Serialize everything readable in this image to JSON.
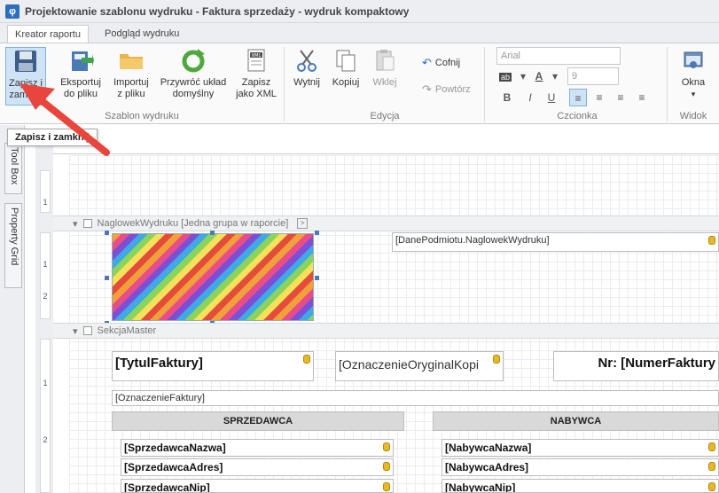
{
  "window": {
    "title": "Projektowanie szablonu wydruku - Faktura sprzedaży - wydruk kompaktowy"
  },
  "tabs": {
    "active": "Kreator raportu",
    "inactive": "Podgląd wydruku"
  },
  "ribbon": {
    "save_line1": "Zapisz i",
    "save_line2": "zamknij",
    "export_line1": "Eksportuj",
    "export_line2": "do pliku",
    "import_line1": "Importuj",
    "import_line2": "z pliku",
    "restore_line1": "Przywróć układ",
    "restore_line2": "domyślny",
    "savexml_line1": "Zapisz",
    "savexml_line2": "jako XML",
    "group_template": "Szablon wydruku",
    "cut": "Wytnij",
    "copy": "Kopiuj",
    "paste": "Wklej",
    "undo": "Cofnij",
    "redo": "Powtórz",
    "group_edit": "Edycja",
    "font_name": "Arial",
    "font_size": "9",
    "group_font": "Czcionka",
    "window_label": "Okna",
    "group_view": "Widok"
  },
  "tooltip": "Zapisz i zamknij",
  "dock": {
    "toolbox": "Tool Box",
    "property_grid": "Property Grid"
  },
  "ruler": {
    "one": "1",
    "two": "2"
  },
  "bands": {
    "header": "NaglowekWydruku [Jedna grupa w raporcie]",
    "master": "SekcjaMaster"
  },
  "fields": {
    "dane_podmiotu": "[DanePodmiotu.NaglowekWydruku]",
    "tytul": "[TytulFaktury]",
    "oznaczenie_oryginal": "[OznaczenieOryginalKopi",
    "nr": "Nr: [NumerFaktury",
    "oznaczenie": "[OznaczenieFaktury]",
    "sprzedawca_head": "SPRZEDAWCA",
    "nabywca_head": "NABYWCA",
    "sprzedawca_nazwa": "[SprzedawcaNazwa]",
    "sprzedawca_adres": "[SprzedawcaAdres]",
    "sprzedawca_nip": "[SprzedawcaNip]",
    "nabywca_nazwa": "[NabywcaNazwa]",
    "nabywca_adres": "[NabywcaAdres]",
    "nabywca_nip": "[NabywcaNip]"
  },
  "colors": {
    "accent": "#2c6fbf",
    "arrow": "#e8453c",
    "selection": "#cfe3f7"
  }
}
